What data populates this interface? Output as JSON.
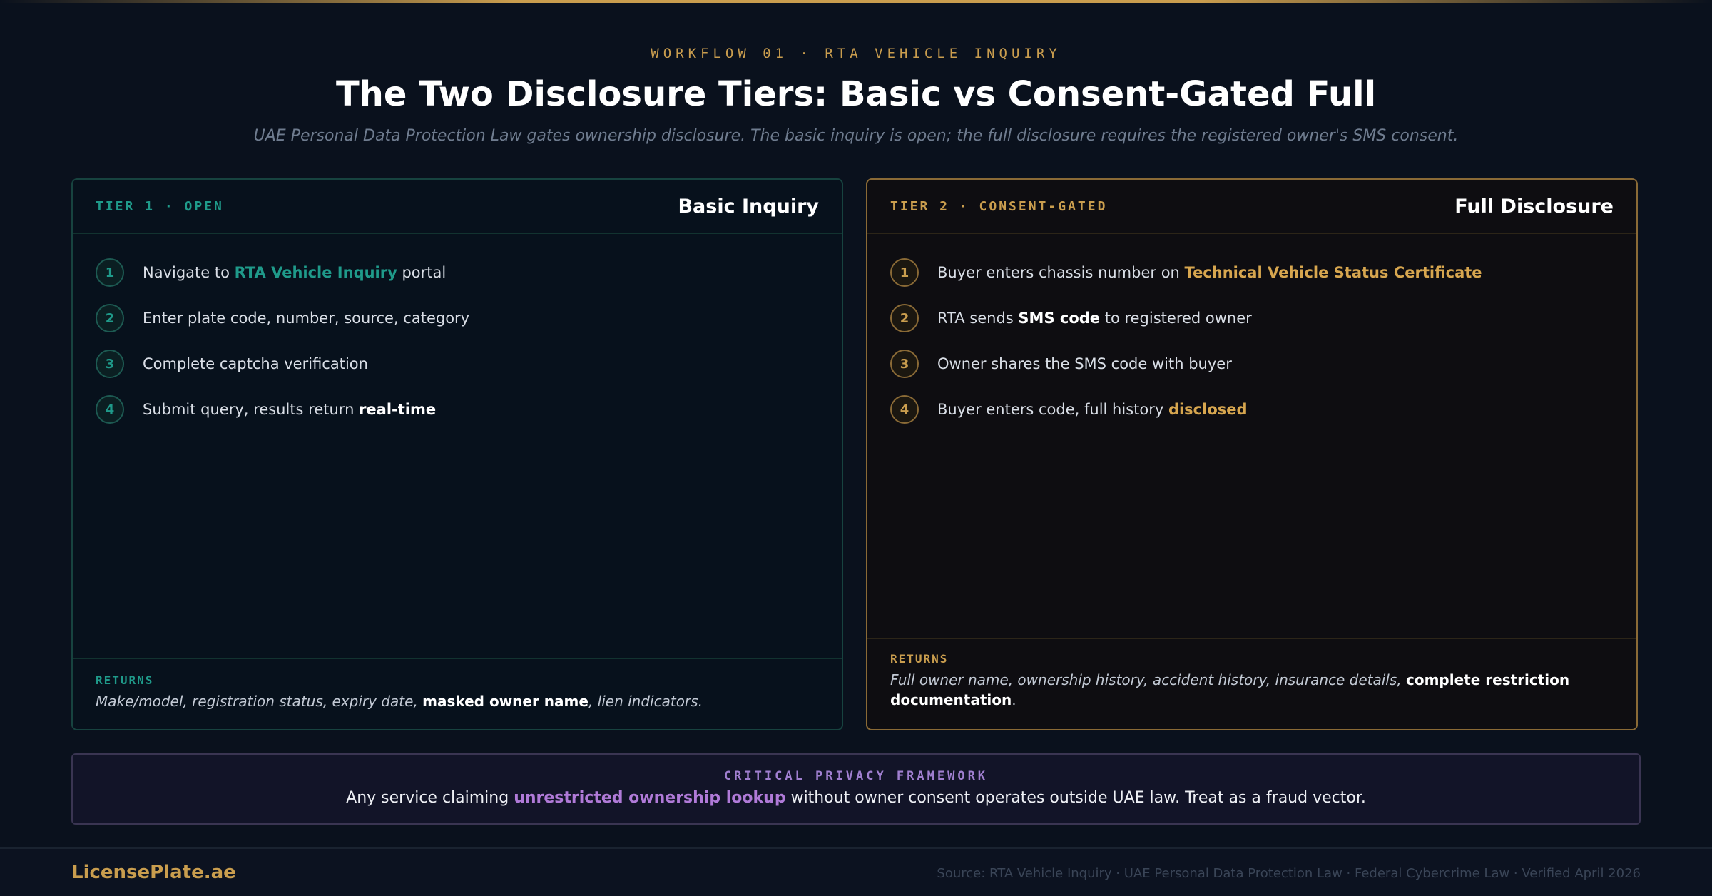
{
  "header": {
    "eyebrow": "WORKFLOW 01 · RTA VEHICLE INQUIRY",
    "title": "The Two Disclosure Tiers: Basic vs Consent-Gated Full",
    "subtitle": "UAE Personal Data Protection Law gates ownership disclosure. The basic inquiry is open; the full disclosure requires the registered owner's SMS consent."
  },
  "tier1": {
    "tag": "TIER 1 · OPEN",
    "title": "Basic Inquiry",
    "steps": [
      {
        "num": "1",
        "pre": "Navigate to ",
        "highlight": "RTA Vehicle Inquiry",
        "post": " portal"
      },
      {
        "num": "2",
        "text": "Enter plate code, number, source, category"
      },
      {
        "num": "3",
        "text": "Complete captcha verification"
      },
      {
        "num": "4",
        "pre": "Submit query, results return ",
        "highlight": "real-time"
      }
    ],
    "returns_label": "RETURNS",
    "returns_pre": "Make/model, registration status, expiry date, ",
    "returns_bold": "masked owner name",
    "returns_post": ", lien indicators."
  },
  "tier2": {
    "tag": "TIER 2 · CONSENT-GATED",
    "title": "Full Disclosure",
    "steps": [
      {
        "num": "1",
        "pre": "Buyer enters chassis number on ",
        "highlight": "Technical Vehicle Status Certificate"
      },
      {
        "num": "2",
        "pre": "RTA sends ",
        "highlight": "SMS code",
        "post": " to registered owner"
      },
      {
        "num": "3",
        "text": "Owner shares the SMS code with buyer"
      },
      {
        "num": "4",
        "pre": "Buyer enters code, full history ",
        "highlight": "disclosed"
      }
    ],
    "returns_label": "RETURNS",
    "returns_pre": "Full owner name, ownership history, accident history, insurance details, ",
    "returns_bold": "complete restriction documentation",
    "returns_post": "."
  },
  "privacy": {
    "label": "CRITICAL PRIVACY FRAMEWORK",
    "pre": "Any service claiming ",
    "highlight": "unrestricted ownership lookup",
    "post": " without owner consent operates outside UAE law. Treat as a fraud vector."
  },
  "footer": {
    "brand": "LicensePlate.ae",
    "source": "Source: RTA Vehicle Inquiry · UAE Personal Data Protection Law · Federal Cybercrime Law · Verified April 2026"
  },
  "colors": {
    "background": "#0a111d",
    "gold_accent": "#c99d4e",
    "teal_accent": "#1f9a8a",
    "purple_accent": "#b07ad8"
  }
}
